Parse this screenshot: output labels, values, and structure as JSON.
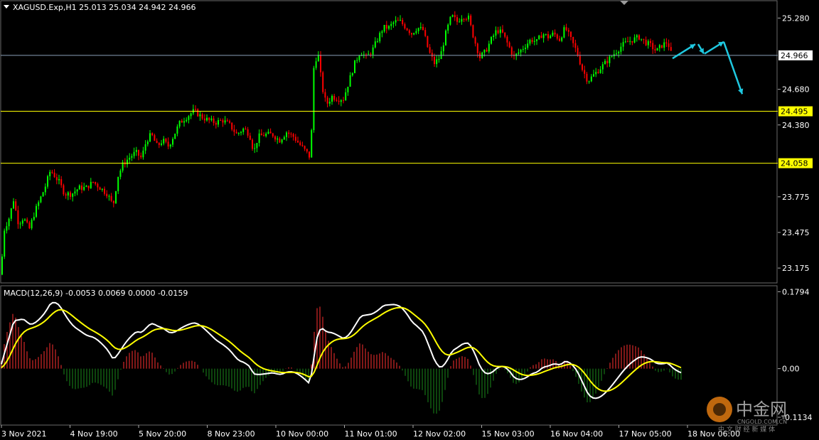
{
  "header": {
    "symbol_line": "XAGUSD.Exp,H1  25.013 25.034 24.942 24.966",
    "macd_line": "MACD(12,26,9) -0.0053 0.0069 0.0000 -0.0159"
  },
  "colors": {
    "background": "#000000",
    "bull": "#00ff00",
    "bear": "#ff0000",
    "level_line": "#ffff00",
    "price_line": "#8aa0b8",
    "arrow": "#1fc8e0",
    "macd_main": "#ffffff",
    "macd_signal": "#ffff00",
    "hist_pos": "#ff3030",
    "hist_neg": "#1a8a1a"
  },
  "chart_data": {
    "type": "candlestick",
    "price_axis": {
      "ylim": [
        23.05,
        25.42
      ],
      "ticks": [
        "25.280",
        "24.680",
        "24.380",
        "23.775",
        "23.475",
        "23.175"
      ],
      "tick_values": [
        25.28,
        24.68,
        24.38,
        23.775,
        23.475,
        23.175
      ]
    },
    "levels": [
      {
        "label": "24.966",
        "value": 24.966,
        "kind": "current"
      },
      {
        "label": "24.495",
        "value": 24.495,
        "kind": "resistance"
      },
      {
        "label": "24.058",
        "value": 24.058,
        "kind": "support"
      }
    ],
    "x_labels": [
      "3 Nov 2021",
      "4 Nov 19:00",
      "5 Nov 20:00",
      "8 Nov 23:00",
      "10 Nov 00:00",
      "11 Nov 01:00",
      "12 Nov 02:00",
      "15 Nov 03:00",
      "16 Nov 04:00",
      "17 Nov 05:00",
      "18 Nov 06:00"
    ],
    "close_path": [
      [
        0,
        23.12
      ],
      [
        5,
        23.5
      ],
      [
        12,
        23.6
      ],
      [
        18,
        23.75
      ],
      [
        25,
        23.55
      ],
      [
        32,
        23.6
      ],
      [
        40,
        23.5
      ],
      [
        48,
        23.65
      ],
      [
        55,
        23.75
      ],
      [
        62,
        23.85
      ],
      [
        70,
        24.0
      ],
      [
        76,
        23.95
      ],
      [
        82,
        23.9
      ],
      [
        90,
        23.8
      ],
      [
        100,
        23.8
      ],
      [
        110,
        23.85
      ],
      [
        120,
        23.85
      ],
      [
        130,
        23.9
      ],
      [
        140,
        23.85
      ],
      [
        150,
        23.8
      ],
      [
        158,
        23.7
      ],
      [
        165,
        23.95
      ],
      [
        172,
        24.05
      ],
      [
        180,
        24.1
      ],
      [
        190,
        24.15
      ],
      [
        198,
        24.1
      ],
      [
        205,
        24.25
      ],
      [
        212,
        24.3
      ],
      [
        220,
        24.2
      ],
      [
        228,
        24.25
      ],
      [
        236,
        24.2
      ],
      [
        244,
        24.3
      ],
      [
        252,
        24.4
      ],
      [
        262,
        24.45
      ],
      [
        272,
        24.5
      ],
      [
        282,
        24.45
      ],
      [
        292,
        24.42
      ],
      [
        302,
        24.4
      ],
      [
        312,
        24.42
      ],
      [
        322,
        24.38
      ],
      [
        332,
        24.3
      ],
      [
        342,
        24.35
      ],
      [
        350,
        24.3
      ],
      [
        356,
        24.15
      ],
      [
        362,
        24.28
      ],
      [
        372,
        24.3
      ],
      [
        382,
        24.3
      ],
      [
        392,
        24.25
      ],
      [
        402,
        24.32
      ],
      [
        412,
        24.28
      ],
      [
        420,
        24.22
      ],
      [
        430,
        24.15
      ],
      [
        436,
        24.1
      ],
      [
        440,
        24.85
      ],
      [
        446,
        25.0
      ],
      [
        452,
        24.7
      ],
      [
        458,
        24.55
      ],
      [
        466,
        24.62
      ],
      [
        474,
        24.6
      ],
      [
        482,
        24.6
      ],
      [
        490,
        24.75
      ],
      [
        498,
        24.9
      ],
      [
        506,
        25.0
      ],
      [
        514,
        24.95
      ],
      [
        522,
        25.0
      ],
      [
        530,
        25.1
      ],
      [
        538,
        25.2
      ],
      [
        546,
        25.2
      ],
      [
        554,
        25.25
      ],
      [
        562,
        25.25
      ],
      [
        570,
        25.2
      ],
      [
        578,
        25.15
      ],
      [
        586,
        25.2
      ],
      [
        594,
        25.18
      ],
      [
        602,
        25.0
      ],
      [
        610,
        24.9
      ],
      [
        618,
        24.95
      ],
      [
        626,
        25.15
      ],
      [
        634,
        25.3
      ],
      [
        642,
        25.25
      ],
      [
        650,
        25.3
      ],
      [
        658,
        25.28
      ],
      [
        666,
        25.1
      ],
      [
        674,
        24.95
      ],
      [
        682,
        25.0
      ],
      [
        690,
        25.1
      ],
      [
        698,
        25.18
      ],
      [
        706,
        25.15
      ],
      [
        714,
        25.05
      ],
      [
        722,
        24.95
      ],
      [
        730,
        25.0
      ],
      [
        738,
        25.05
      ],
      [
        746,
        25.1
      ],
      [
        754,
        25.08
      ],
      [
        762,
        25.15
      ],
      [
        770,
        25.12
      ],
      [
        778,
        25.15
      ],
      [
        786,
        25.1
      ],
      [
        794,
        25.2
      ],
      [
        802,
        25.1
      ],
      [
        810,
        25.0
      ],
      [
        818,
        24.85
      ],
      [
        826,
        24.75
      ],
      [
        834,
        24.8
      ],
      [
        842,
        24.85
      ],
      [
        850,
        24.9
      ],
      [
        858,
        24.95
      ],
      [
        866,
        25.0
      ],
      [
        874,
        25.05
      ],
      [
        882,
        25.08
      ],
      [
        890,
        25.1
      ],
      [
        898,
        25.12
      ],
      [
        906,
        25.08
      ],
      [
        914,
        25.05
      ],
      [
        922,
        25.0
      ],
      [
        930,
        25.05
      ],
      [
        938,
        25.08
      ],
      [
        944,
        24.96
      ]
    ],
    "macd": {
      "ylim": [
        -0.13,
        0.19
      ],
      "ticks": [
        "0.1794",
        "0.00",
        "-0.1134"
      ],
      "tick_values": [
        0.1794,
        0.0,
        -0.1134
      ]
    }
  }
}
